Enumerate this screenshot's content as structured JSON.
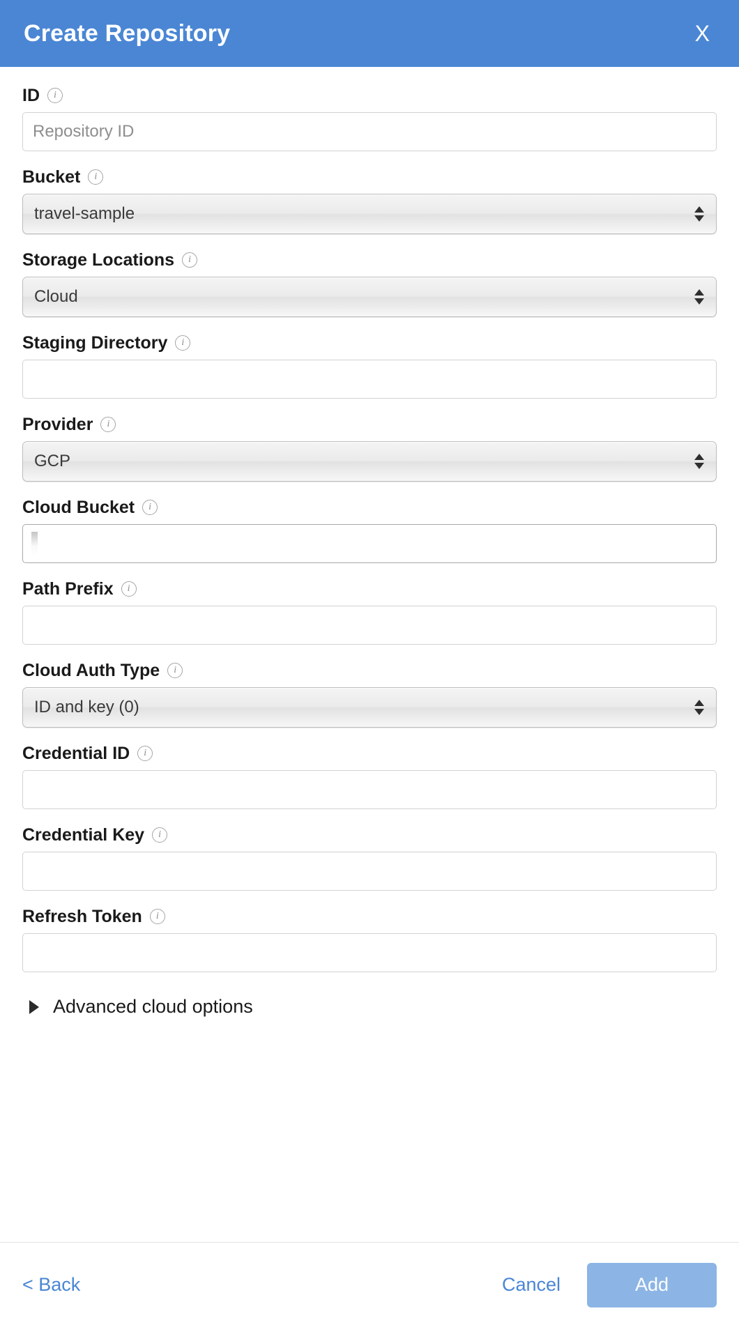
{
  "header": {
    "title": "Create Repository",
    "close_label": "X"
  },
  "fields": [
    {
      "label": "ID",
      "name": "id",
      "type": "text",
      "value": "",
      "placeholder": "Repository ID",
      "focused": false
    },
    {
      "label": "Bucket",
      "name": "bucket",
      "type": "select",
      "value": "travel-sample"
    },
    {
      "label": "Storage Locations",
      "name": "storage-locations",
      "type": "select",
      "value": "Cloud"
    },
    {
      "label": "Staging Directory",
      "name": "staging-directory",
      "type": "text",
      "value": "",
      "placeholder": "",
      "focused": false
    },
    {
      "label": "Provider",
      "name": "provider",
      "type": "select",
      "value": "GCP"
    },
    {
      "label": "Cloud Bucket",
      "name": "cloud-bucket",
      "type": "text",
      "value": "",
      "placeholder": "",
      "focused": true
    },
    {
      "label": "Path Prefix",
      "name": "path-prefix",
      "type": "text",
      "value": "",
      "placeholder": "",
      "focused": false
    },
    {
      "label": "Cloud Auth Type",
      "name": "cloud-auth-type",
      "type": "select",
      "value": "ID and key (0)"
    },
    {
      "label": "Credential ID",
      "name": "credential-id",
      "type": "text",
      "value": "",
      "placeholder": "",
      "focused": false
    },
    {
      "label": "Credential Key",
      "name": "credential-key",
      "type": "text",
      "value": "",
      "placeholder": "",
      "focused": false
    },
    {
      "label": "Refresh Token",
      "name": "refresh-token",
      "type": "text",
      "value": "",
      "placeholder": "",
      "focused": false
    }
  ],
  "advanced": {
    "label": "Advanced cloud options",
    "expanded": false
  },
  "footer": {
    "back_label": "< Back",
    "cancel_label": "Cancel",
    "add_label": "Add"
  },
  "colors": {
    "header_blue": "#4a86d4",
    "link_blue": "#4a86d4",
    "add_button_blue": "#8cb5e5"
  }
}
